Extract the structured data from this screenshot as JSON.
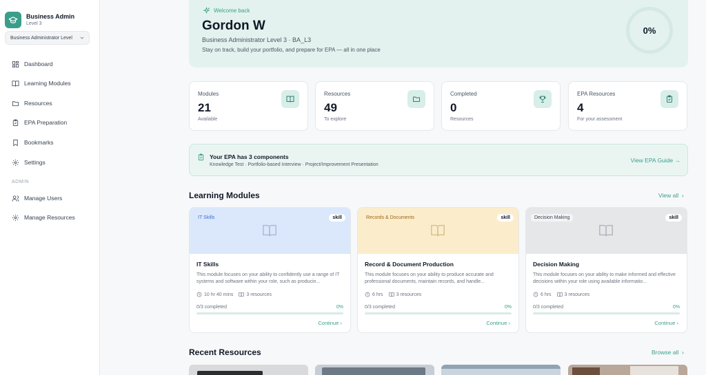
{
  "brand": {
    "name": "Business Admin",
    "level": "Level 3"
  },
  "level_select": {
    "value": "Business Administrator Level"
  },
  "nav": {
    "items": [
      {
        "label": "Dashboard",
        "icon": "dashboard-icon"
      },
      {
        "label": "Learning Modules",
        "icon": "book-icon"
      },
      {
        "label": "Resources",
        "icon": "folder-icon"
      },
      {
        "label": "EPA Preparation",
        "icon": "clipboard-check-icon"
      },
      {
        "label": "Bookmarks",
        "icon": "bookmark-icon"
      },
      {
        "label": "Settings",
        "icon": "gear-icon"
      }
    ],
    "admin_heading": "ADMIN",
    "admin_items": [
      {
        "label": "Manage Users",
        "icon": "users-icon"
      },
      {
        "label": "Manage Resources",
        "icon": "gear-icon"
      }
    ]
  },
  "welcome": {
    "tag": "Welcome back",
    "name": "Gordon W",
    "subtitle": "Business Administrator Level 3 · BA_L3",
    "description": "Stay on track, build your portfolio, and prepare for EPA — all in one place",
    "progress": "0%"
  },
  "stats": [
    {
      "title": "Modules",
      "value": "21",
      "sub": "Available",
      "icon": "book-icon"
    },
    {
      "title": "Resources",
      "value": "49",
      "sub": "To explore",
      "icon": "folder-icon"
    },
    {
      "title": "Completed",
      "value": "0",
      "sub": "Resources",
      "icon": "trophy-icon"
    },
    {
      "title": "EPA Resources",
      "value": "4",
      "sub": "For your assessment",
      "icon": "clipboard-check-icon"
    }
  ],
  "epa_banner": {
    "title": "Your EPA has 3 components",
    "components": "Knowledge Test · Portfolio-based Interview · Project/Improvement Presentation",
    "link": "View EPA Guide →"
  },
  "learning_modules": {
    "title": "Learning Modules",
    "view_all": "View all",
    "cards": [
      {
        "category": "IT Skills",
        "badge": "skill",
        "title": "IT Skills",
        "description": "This module focuses on your ability to confidently use a range of IT systems and software within your role, such as producin...",
        "duration": "10 hr 40 mins",
        "resources": "3 resources",
        "progress_label": "0/3 completed",
        "progress_pct": "0%",
        "progress": 0,
        "continue": "Continue",
        "colors": {
          "banner": "#dbe8fb",
          "cat_bg": "#dbe8fb",
          "cat_text": "#3b6fd1"
        }
      },
      {
        "category": "Records & Documents",
        "badge": "skill",
        "title": "Record & Document Production",
        "description": "This module focuses on your ability to produce accurate and professional documents, maintain records, and handle...",
        "duration": "6 hrs",
        "resources": "3 resources",
        "progress_label": "0/3 completed",
        "progress_pct": "0%",
        "progress": 0,
        "continue": "Continue",
        "colors": {
          "banner": "#fbeccb",
          "cat_bg": "#fbeccb",
          "cat_text": "#a0651a"
        }
      },
      {
        "category": "Decision Making",
        "badge": "skill",
        "title": "Decision Making",
        "description": "This module focuses on your ability to make informed and effective decisions within your role using available informatio...",
        "duration": "6 hrs",
        "resources": "3 resources",
        "progress_label": "0/3 completed",
        "progress_pct": "0%",
        "progress": 0,
        "continue": "Continue",
        "colors": {
          "banner": "#e6e7e9",
          "cat_bg": "#f3f4f6",
          "cat_text": "#374151"
        }
      }
    ]
  },
  "recent_resources": {
    "title": "Recent Resources",
    "browse_all": "Browse all"
  },
  "colors": {
    "accent": "#3a9e8a"
  }
}
